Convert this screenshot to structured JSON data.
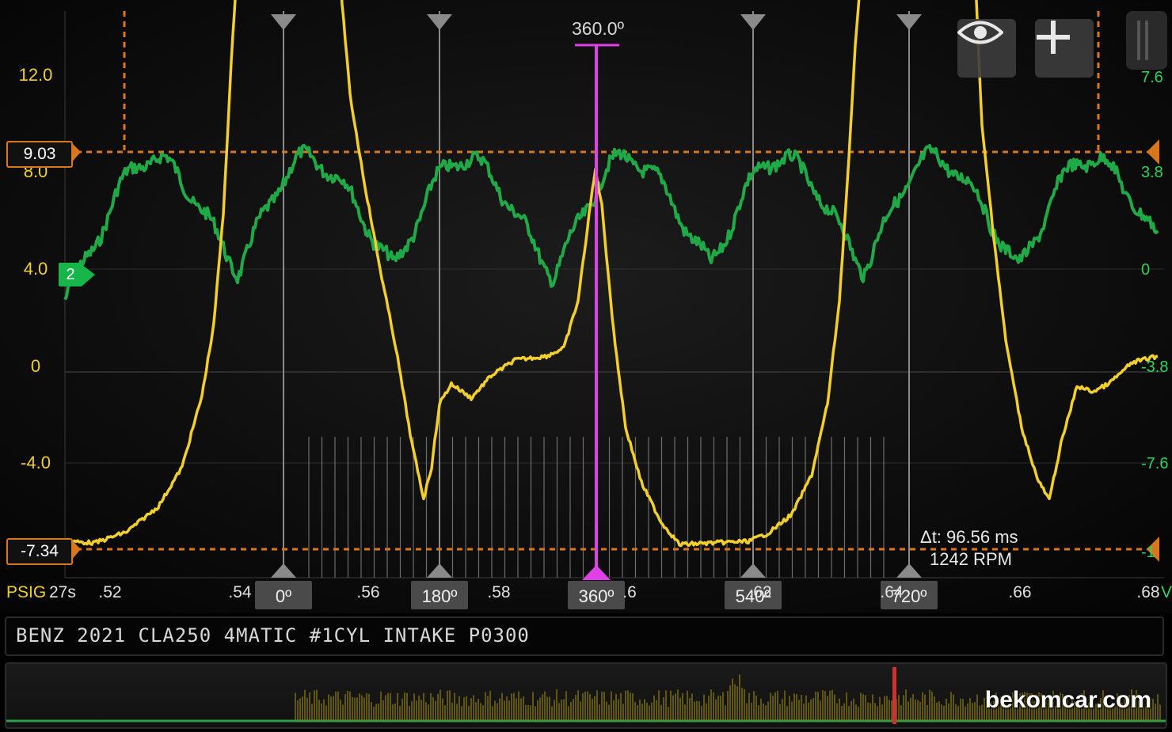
{
  "title": "BENZ 2021 CLA250 4MATIC #1CYL INTAKE P0300",
  "watermark": "bekomcar.com",
  "colors": {
    "pressure": "#f2cf2b",
    "channel2": "#1faa47",
    "cursor_line": "#e040e8",
    "limit_marker": "#d9771d",
    "axis_text_left": "#f2cf2b",
    "axis_text_right": "#2fd35a"
  },
  "y_axis_left": {
    "unit": "PSIG",
    "ticks": [
      "12.0",
      "8.0",
      "4.0",
      "0",
      "-4.0"
    ]
  },
  "y_axis_right": {
    "unit": "V",
    "ticks": [
      "7.6",
      "3.8",
      "0",
      "-3.8",
      "-7.6",
      "-1"
    ]
  },
  "x_axis": {
    "unit": "27s",
    "ticks": [
      ".52",
      ".54",
      ".56",
      ".58",
      ".6",
      ".62",
      ".64",
      ".66",
      ".68"
    ]
  },
  "limit_markers": {
    "upper": "9.03",
    "lower": "-7.34"
  },
  "channel_badge": "2",
  "crank_angles": [
    "0º",
    "180º",
    "360º",
    "540º",
    "720º"
  ],
  "active_cursor": "360.0º",
  "measurement": {
    "delta_t": "Δt: 96.56 ms",
    "rpm": "1242 RPM"
  },
  "buttons": {
    "visibility": "eye-icon",
    "add": "plus-icon"
  }
}
